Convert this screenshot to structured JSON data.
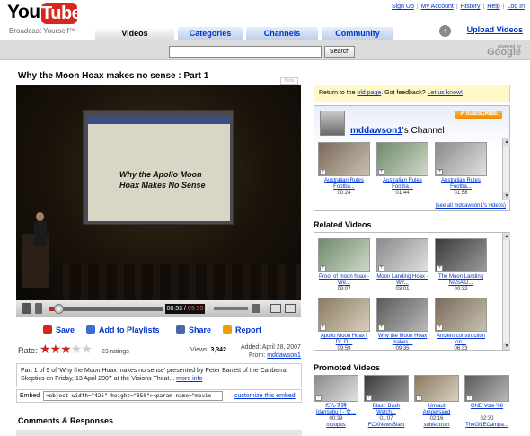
{
  "header": {
    "logo_you": "You",
    "logo_tube": "Tube",
    "tagline": "Broadcast Yourself™",
    "links": [
      "Sign Up",
      "My Account",
      "History",
      "Help",
      "Log In"
    ],
    "tabs": [
      "Videos",
      "Categories",
      "Channels",
      "Community"
    ],
    "active_tab": "Videos",
    "upload_label": "Upload Videos",
    "search_button": "Search",
    "search_value": "",
    "powered_by": "powered by",
    "google": "Google"
  },
  "video": {
    "title": "Why the Moon Hoax makes no sense : Part 1",
    "corner_label": "Beta",
    "slide_text_1": "Why the Apollo Moon",
    "slide_text_2": "Hoax Makes No Sense",
    "time_current": "00:53",
    "time_total": "09:55",
    "progress": 0.089,
    "actions": [
      "Save",
      "Add to Playlists",
      "Share",
      "Report"
    ],
    "rate_label": "Rate:",
    "rating": 3,
    "rating_max": 5,
    "ratings_count": "23 ratings",
    "views_label": "Views:",
    "views": "3,342",
    "added_label": "Added:",
    "added_date": "April 28, 2007",
    "from_label": "From:",
    "from_user": "mddawson1",
    "description": "Part 1 of 9 of 'Why the Moon Hoax makes no sense' presented by Peter Barrett of the Canberra Skeptics on Friday, 13 April 2007 at the Visions Theat...",
    "more_info": "more info",
    "embed_label": "Embed",
    "embed_code": "<object width=\"425\" height=\"350\"><param name=\"movie",
    "customize_embed": "customize this embed",
    "comments_title": "Comments & Responses"
  },
  "sidebar": {
    "notice_text": "Return to the",
    "notice_link": "old page",
    "notice_text2": ". Got feedback?",
    "notice_link2": "Let us know!",
    "channel_user": "mddawson1",
    "channel_suffix": "'s Channel",
    "subscribe_label": "SUBSCRIBE",
    "channel_videos": [
      {
        "caption": "Australian Rules Footba...",
        "duration": "00:24"
      },
      {
        "caption": "Australian Rules Footba...",
        "duration": "01:44"
      },
      {
        "caption": "Australian Rules Footba...",
        "duration": "01:58"
      }
    ],
    "see_all": "(see all mddawson1's videos)",
    "related_title": "Related Videos",
    "related_videos": [
      {
        "caption": "Proof of moon hoax - We...",
        "duration": "09:07"
      },
      {
        "caption": "Moon Landing Hoax - Wir...",
        "duration": "03:01"
      },
      {
        "caption": "The Moon Landing NASA D...",
        "duration": "00:32"
      },
      {
        "caption": "Apollo Moon Hoax? Dr. D...",
        "duration": "09:59"
      },
      {
        "caption": "Why the Moon Hoax makes...",
        "duration": "09:35"
      },
      {
        "caption": "Ancient construction on...",
        "duration": "06:33"
      }
    ],
    "promoted_title": "Promoted Videos",
    "promoted_videos": [
      {
        "caption": "だんす詩 [dansubu ] - 女...",
        "duration": "00:39",
        "user": "moopus"
      },
      {
        "caption": "Blast: Bush Watch...",
        "duration": "01:07",
        "user": "FOXNewsBlast"
      },
      {
        "caption": "Umlaut Ampersand",
        "duration": "02:16",
        "user": "subiectruin"
      },
      {
        "caption": "ONE Vote '08",
        "duration": "02:30",
        "user": "TheONECampa..."
      }
    ]
  },
  "colors": {
    "link": "#0033cc",
    "youtube_red": "#d8261d",
    "subscribe": "#f08a00"
  }
}
